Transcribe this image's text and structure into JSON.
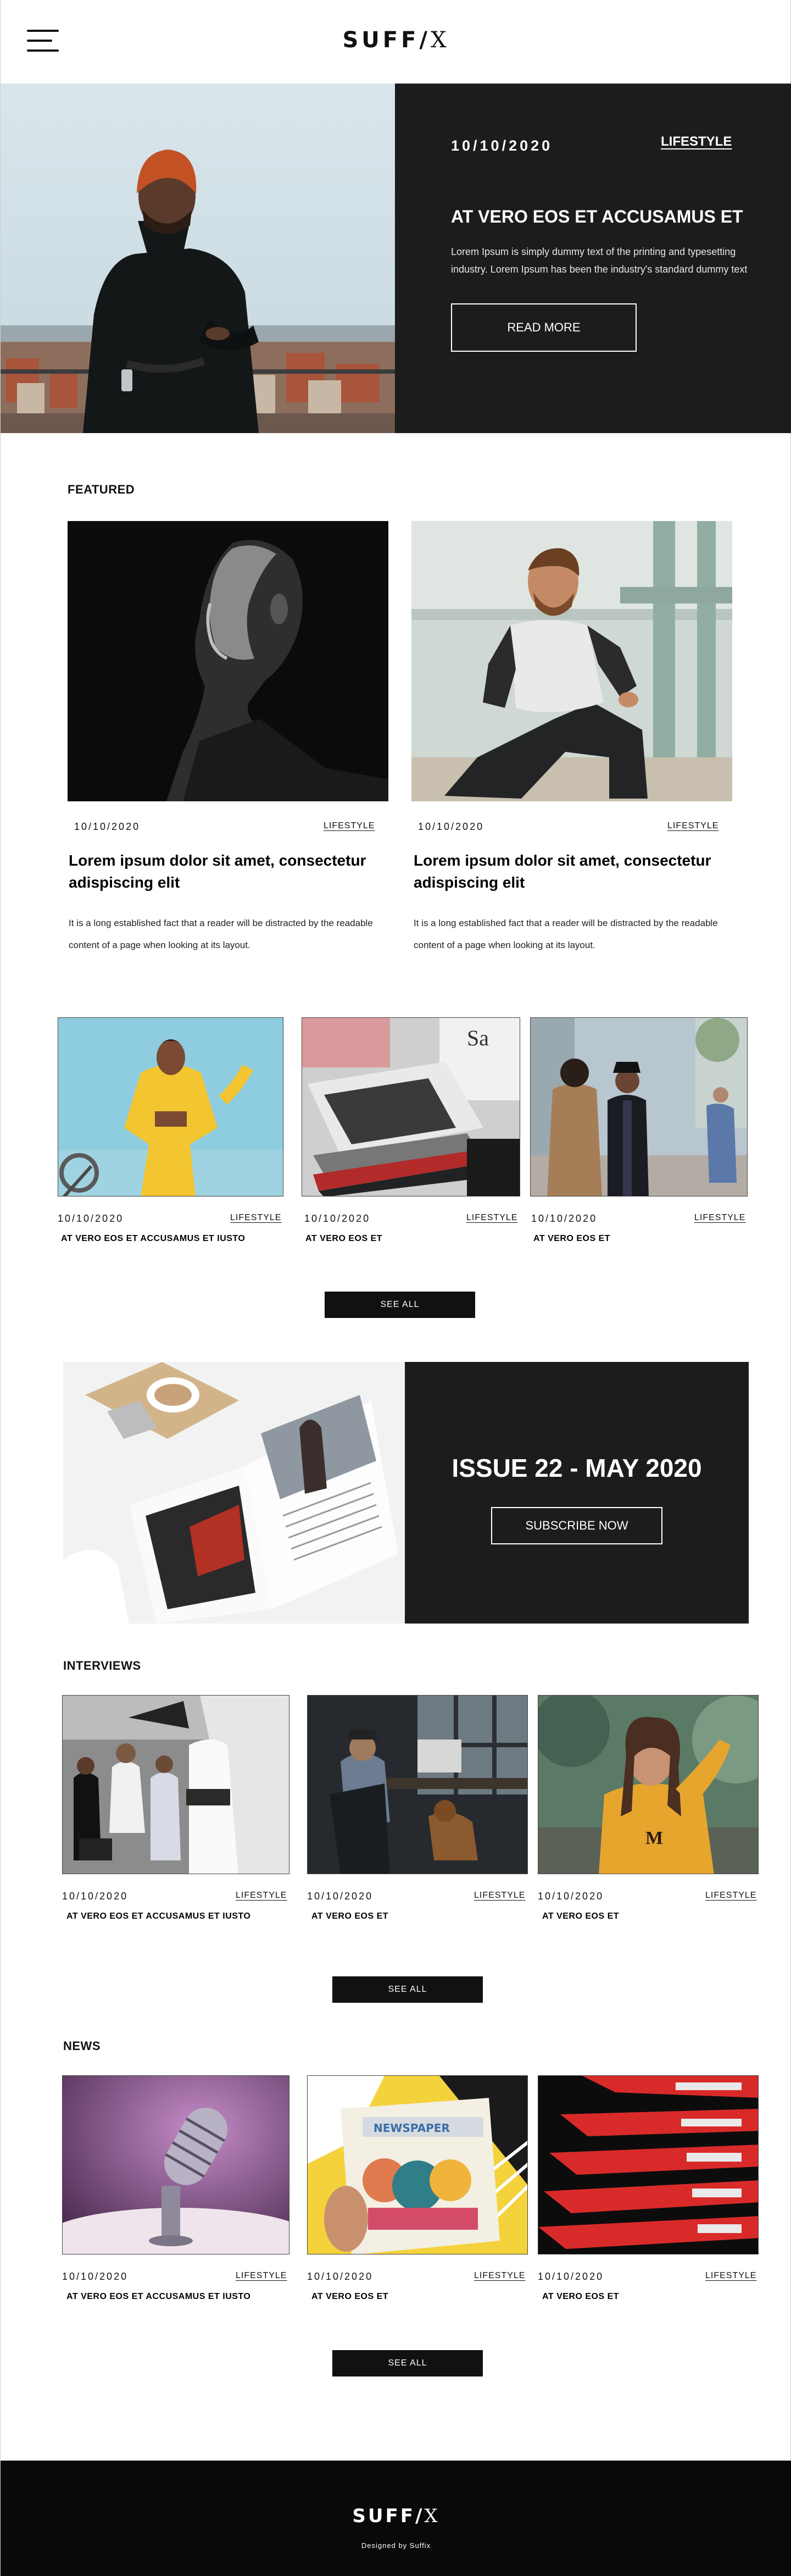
{
  "header": {
    "logo_main": "SUFF",
    "logo_slash": "/",
    "logo_x": "X"
  },
  "hero": {
    "date": "10/10/2020",
    "category": "LIFESTYLE",
    "title": "AT  VERO EOS ET ACCUSAMUS ET",
    "text": "Lorem Ipsum is simply dummy text of the printing and typesetting industry. Lorem Ipsum has been the industry's standard dummy text",
    "button": "READ MORE"
  },
  "featured": {
    "label": "FEATURED",
    "items": [
      {
        "date": "10/10/2020",
        "category": "LIFESTYLE",
        "title": "Lorem ipsum dolor sit amet, consectetur adispiscing elit",
        "text": "It is a long established fact that a reader will be distracted by the readable content of a page when looking at its layout."
      },
      {
        "date": "10/10/2020",
        "category": "LIFESTYLE",
        "title": "Lorem ipsum dolor sit amet, consectetur adispiscing elit",
        "text": "It is a long established fact that a reader will be distracted by the readable content of a page when looking at its layout."
      }
    ]
  },
  "trio": {
    "items": [
      {
        "date": "10/10/2020",
        "category": "LIFESTYLE",
        "title": "AT VERO EOS ET ACCUSAMUS ET IUSTO"
      },
      {
        "date": "10/10/2020",
        "category": "LIFESTYLE",
        "title": "AT VERO EOS ET"
      },
      {
        "date": "10/10/2020",
        "category": "LIFESTYLE",
        "title": "AT VERO EOS ET"
      }
    ],
    "see_all": "SEE ALL"
  },
  "issue": {
    "title": "ISSUE 22 - MAY 2020",
    "button": "SUBSCRIBE NOW"
  },
  "interviews": {
    "label": "INTERVIEWS",
    "items": [
      {
        "date": "10/10/2020",
        "category": "LIFESTYLE",
        "title": "AT VERO EOS ET ACCUSAMUS ET IUSTO"
      },
      {
        "date": "10/10/2020",
        "category": "LIFESTYLE",
        "title": "AT VERO EOS ET"
      },
      {
        "date": "10/10/2020",
        "category": "LIFESTYLE",
        "title": "AT VERO EOS ET"
      }
    ],
    "see_all": "SEE ALL"
  },
  "news": {
    "label": "NEWS",
    "items": [
      {
        "date": "10/10/2020",
        "category": "LIFESTYLE",
        "title": "AT VERO EOS ET ACCUSAMUS ET IUSTO"
      },
      {
        "date": "10/10/2020",
        "category": "LIFESTYLE",
        "title": "AT VERO EOS ET"
      },
      {
        "date": "10/10/2020",
        "category": "LIFESTYLE",
        "title": "AT VERO EOS ET"
      }
    ],
    "see_all": "SEE ALL",
    "newspaper_text": "NEWSPAPER"
  },
  "footer": {
    "logo_main": "SUFF",
    "logo_slash": "/",
    "logo_x": "X",
    "credit": "Designed by Suffix"
  },
  "colors": {
    "dark_panel": "#1c1c1c",
    "footer": "#090909",
    "button": "#111111"
  }
}
